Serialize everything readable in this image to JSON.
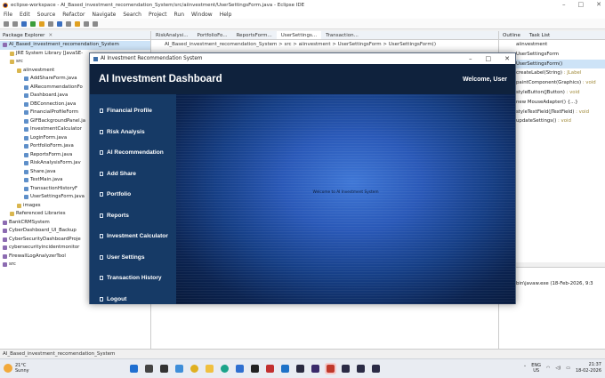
{
  "ide": {
    "window_title": "eclipse-workspace - AI_Based_investment_recomendation_System/src/aiinvestment/UserSettingsForm.java - Eclipse IDE",
    "menu": [
      "File",
      "Edit",
      "Source",
      "Refactor",
      "Navigate",
      "Search",
      "Project",
      "Run",
      "Window",
      "Help"
    ],
    "package_explorer": {
      "title": "Package Explorer",
      "items": [
        {
          "label": "AI_Based_investment_recomendation_System",
          "indent": 0,
          "selected": true
        },
        {
          "label": "JRE System Library [JavaSE-",
          "indent": 1
        },
        {
          "label": "src",
          "indent": 1
        },
        {
          "label": "aiinvestment",
          "indent": 2
        },
        {
          "label": "AddShareForm.java",
          "indent": 3
        },
        {
          "label": "AIRecommendationFo",
          "indent": 3
        },
        {
          "label": "Dashboard.java",
          "indent": 3
        },
        {
          "label": "DBConnection.java",
          "indent": 3
        },
        {
          "label": "FinancialProfileForm",
          "indent": 3
        },
        {
          "label": "GIFBackgroundPanel.ja",
          "indent": 3
        },
        {
          "label": "InvestmentCalculator",
          "indent": 3
        },
        {
          "label": "LoginForm.java",
          "indent": 3
        },
        {
          "label": "PortfolioForm.java",
          "indent": 3
        },
        {
          "label": "ReportsForm.java",
          "indent": 3
        },
        {
          "label": "RiskAnalysisForm.jav",
          "indent": 3
        },
        {
          "label": "Share.java",
          "indent": 3
        },
        {
          "label": "TestMain.java",
          "indent": 3
        },
        {
          "label": "TransactionHistoryF",
          "indent": 3
        },
        {
          "label": "UserSettingsForm.java",
          "indent": 3
        },
        {
          "label": "images",
          "indent": 2
        },
        {
          "label": "Referenced Libraries",
          "indent": 1
        },
        {
          "label": "BankCRMSystem",
          "indent": 0
        },
        {
          "label": "CyberDashboard_UI_Backup",
          "indent": 0
        },
        {
          "label": "CyberSecurityDashboardProje",
          "indent": 0
        },
        {
          "label": "cybersecurityincidentmonitor",
          "indent": 0
        },
        {
          "label": "FirewallLogAnalyzerTool",
          "indent": 0
        },
        {
          "label": "src",
          "indent": 0
        }
      ]
    },
    "editor_tabs": [
      "RiskAnalysi...",
      "PortfolioFo...",
      "ReportsForm...",
      "UserSettings...",
      "Transaction..."
    ],
    "breadcrumb": "AI_Based_investment_recomendation_System > src > aiinvestment > UserSettingsForm > UserSettingsForm()",
    "outline": {
      "title": "Outline",
      "task_list": "Task List",
      "items": [
        {
          "name": "aiinvestment",
          "type": ""
        },
        {
          "name": "UserSettingsForm",
          "type": ""
        },
        {
          "name": "UserSettingsForm()",
          "type": ""
        },
        {
          "name": "createLabel(String)",
          "type": ": JLabel"
        },
        {
          "name": "paintComponent(Graphics)",
          "type": ": void"
        },
        {
          "name": "styleButton(JButton)",
          "type": ": void"
        },
        {
          "name": "new MouseAdapter() {...}",
          "type": ""
        },
        {
          "name": "styleTextField(JTextField)",
          "type": ": void"
        },
        {
          "name": "updateSettings()",
          "type": ": void"
        }
      ]
    },
    "console_line": "bin\\javaw.exe  (18-Feb-2026, 9:3",
    "status_bar": "AI_Based_investment_recomendation_System"
  },
  "app": {
    "window_title": "AI Investment Recommendation System",
    "header_title": "AI Investment Dashboard",
    "welcome": "Welcome, User",
    "nav": [
      {
        "label": "Financial Profile",
        "name": "financial-profile"
      },
      {
        "label": "Risk Analysis",
        "name": "risk-analysis"
      },
      {
        "label": "AI Recommendation",
        "name": "ai-recommendation"
      },
      {
        "label": "Add Share",
        "name": "add-share"
      },
      {
        "label": "Portfolio",
        "name": "portfolio"
      },
      {
        "label": "Reports",
        "name": "reports"
      },
      {
        "label": "Investment Calculator",
        "name": "investment-calculator"
      },
      {
        "label": "User Settings",
        "name": "user-settings"
      },
      {
        "label": "Transaction History",
        "name": "transaction-history"
      },
      {
        "label": "Logout",
        "name": "logout"
      }
    ],
    "content_message": "Welcome to AI Investment System",
    "colors": {
      "header_bg": "#0f223d",
      "sidebar_bg": "#163a66",
      "content_center": "#3f77d6",
      "content_edge": "#081a3b"
    }
  },
  "taskbar": {
    "temperature": "21°C",
    "weather": "Sunny",
    "language": "ENG",
    "region": "US",
    "time": "21:37",
    "date": "18-02-2026",
    "apps": [
      {
        "name": "start",
        "color": "#1f6fd1"
      },
      {
        "name": "search",
        "color": "#444444"
      },
      {
        "name": "task-view",
        "color": "#333333"
      },
      {
        "name": "widgets",
        "color": "#3f8ed9"
      },
      {
        "name": "chrome",
        "color": "#e0b020"
      },
      {
        "name": "file-explorer",
        "color": "#f0c040"
      },
      {
        "name": "edge",
        "color": "#1aa38a"
      },
      {
        "name": "store",
        "color": "#2f6fd0"
      },
      {
        "name": "app-dark",
        "color": "#222222"
      },
      {
        "name": "app-red",
        "color": "#c23030"
      },
      {
        "name": "outlook",
        "color": "#1e72c8"
      },
      {
        "name": "app-dark-2",
        "color": "#2a2a40"
      },
      {
        "name": "eclipse",
        "color": "#3a2a6a"
      },
      {
        "name": "java-app",
        "color": "#c0392b"
      },
      {
        "name": "app-dark-3",
        "color": "#2b2b45"
      },
      {
        "name": "app-dark-4",
        "color": "#2b2b45"
      },
      {
        "name": "app-dark-5",
        "color": "#2b2b45"
      }
    ]
  }
}
